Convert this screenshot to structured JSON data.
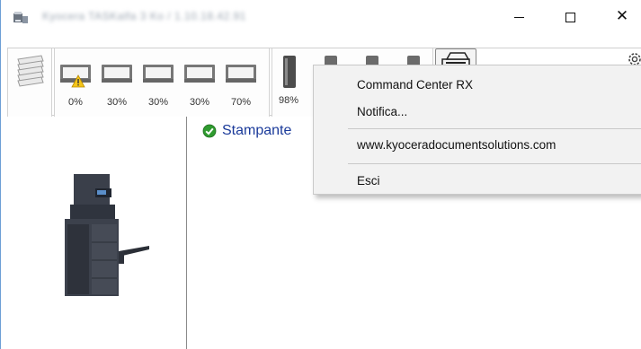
{
  "window": {
    "title": "Kyocera TASKalfa 3 Ko / 1.10.18.42.91",
    "controls": {
      "minimize_icon": "minimize-icon",
      "maximize_icon": "maximize-icon",
      "close_glyph": "✕"
    }
  },
  "toolbar": {
    "trays": [
      {
        "label": "0%",
        "warning": true,
        "level": 0
      },
      {
        "label": "30%",
        "warning": false,
        "level": 30
      },
      {
        "label": "30%",
        "warning": false,
        "level": 30
      },
      {
        "label": "30%",
        "warning": false,
        "level": 30
      },
      {
        "label": "70%",
        "warning": false,
        "level": 70
      }
    ],
    "toners": [
      {
        "name": "black",
        "label": "98%",
        "color": "#555555"
      },
      {
        "name": "cyan",
        "label": "",
        "color": "#3fb6e6"
      },
      {
        "name": "magenta",
        "label": "",
        "color": "#e23a9b"
      },
      {
        "name": "yellow",
        "label": "",
        "color": "#f2d21a"
      }
    ]
  },
  "status": {
    "text": "Stampante",
    "icon": "check-icon",
    "icon_color": "#2f9b2f"
  },
  "context_menu": {
    "items": [
      {
        "label": "Command Center RX"
      },
      {
        "label": "Notifica..."
      },
      {
        "label": "www.kyoceradocumentsolutions.com"
      },
      {
        "label": "Esci"
      }
    ]
  }
}
